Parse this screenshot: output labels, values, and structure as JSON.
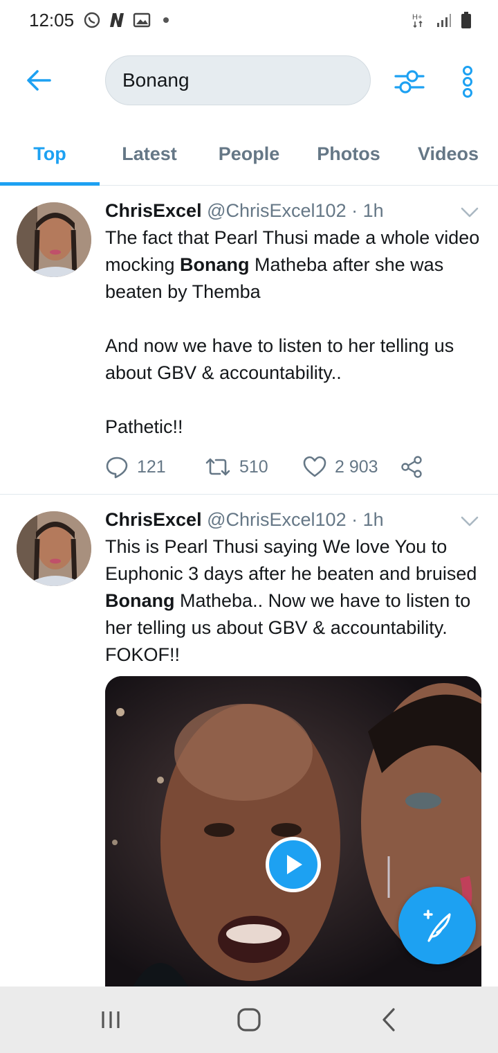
{
  "status_bar": {
    "time": "12:05",
    "icons": [
      "whatsapp-icon",
      "n-app-icon",
      "gallery-icon",
      "notification-dot",
      "hplus-icon",
      "signal-icon",
      "battery-icon"
    ]
  },
  "search": {
    "value": "Bonang",
    "back_icon": "arrow-left-icon",
    "filter_icon": "sliders-icon",
    "more_icon": "more-vertical-icon"
  },
  "tabs": [
    {
      "label": "Top",
      "active": true
    },
    {
      "label": "Latest",
      "active": false
    },
    {
      "label": "People",
      "active": false
    },
    {
      "label": "Photos",
      "active": false
    },
    {
      "label": "Videos",
      "active": false
    }
  ],
  "tweets": [
    {
      "name": "ChrisExcel",
      "handle": "@ChrisExcel102",
      "separator": "·",
      "time": "1h",
      "text_lines": {
        "p1a": "The fact that Pearl Thusi made a whole video mocking ",
        "p1b": "Bonang",
        "p1c": " Matheba after she was beaten by Themba",
        "p2": "And now we have to listen to her telling us about GBV & accountability..",
        "p3": "Pathetic!!"
      },
      "replies": "121",
      "retweets": "510",
      "likes": "2 903"
    },
    {
      "name": "ChrisExcel",
      "handle": "@ChrisExcel102",
      "separator": "·",
      "time": "1h",
      "text_lines": {
        "p1a": "This is Pearl Thusi saying We love You to Euphonic 3 days after he beaten and bruised ",
        "p1b": "Bonang",
        "p1c": " Matheba.. Now we have to listen to her telling us about GBV & accountability. FOKOF!!"
      },
      "media": "video"
    }
  ],
  "colors": {
    "accent": "#1da1f2",
    "text_primary": "#14171a",
    "text_secondary": "#657786",
    "divider": "#e1e8ed"
  }
}
